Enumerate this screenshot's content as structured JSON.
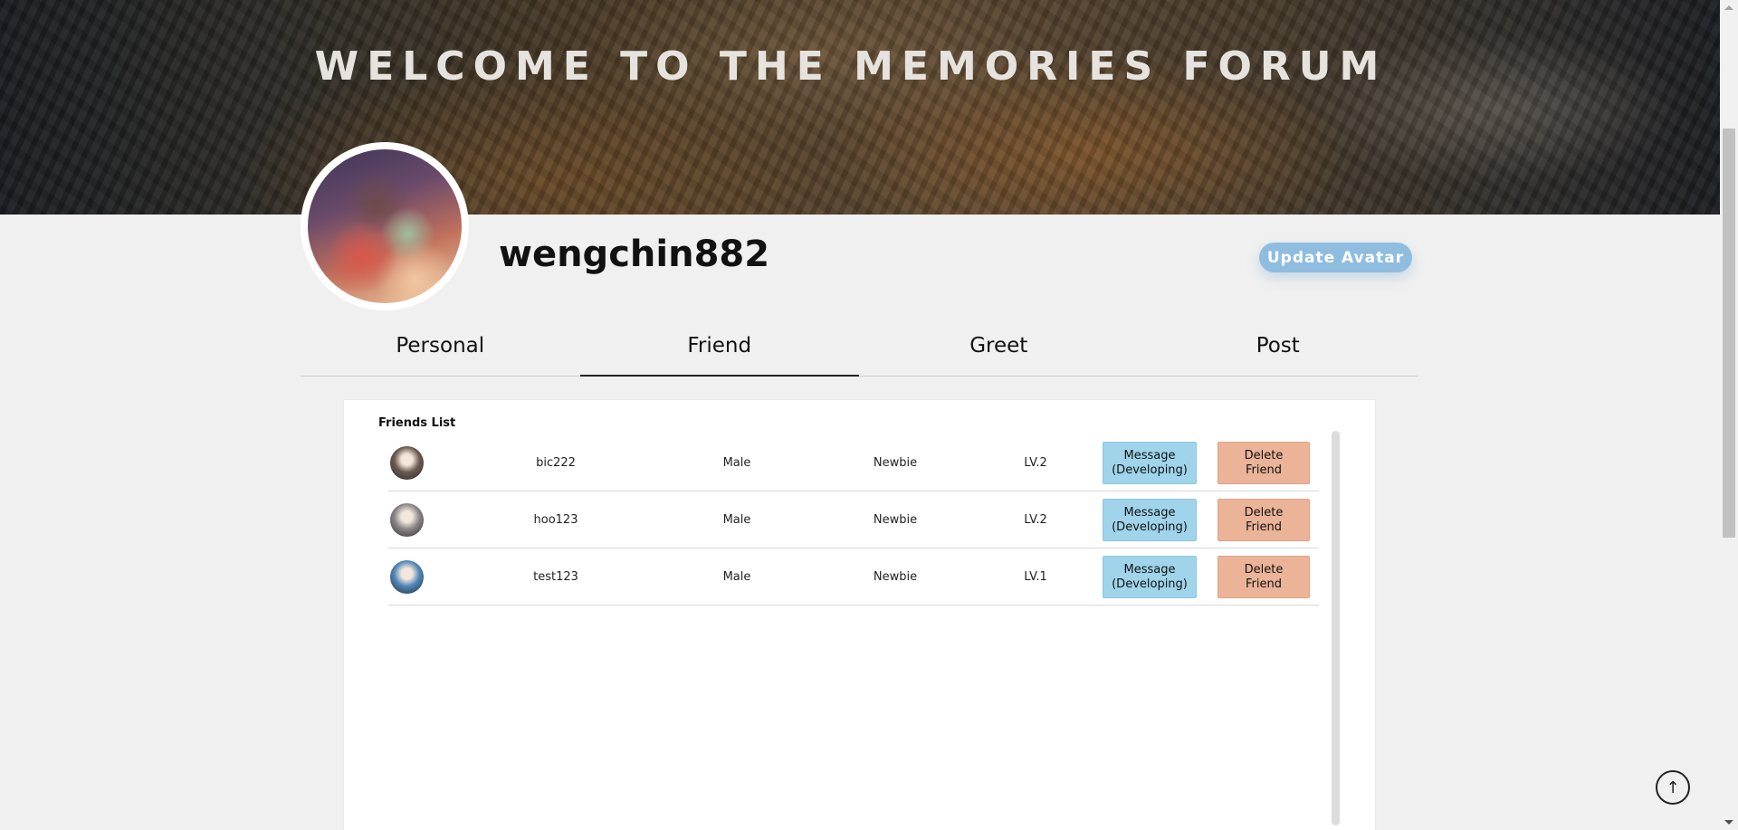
{
  "banner": {
    "title": "WELCOME TO THE MEMORIES FORUM"
  },
  "profile": {
    "username": "wengchin882",
    "update_avatar_label": "Update Avatar"
  },
  "tabs": [
    {
      "label": "Personal",
      "active": false
    },
    {
      "label": "Friend",
      "active": true
    },
    {
      "label": "Greet",
      "active": false
    },
    {
      "label": "Post",
      "active": false
    }
  ],
  "friends": {
    "title": "Friends List",
    "rows": [
      {
        "name": "bic222",
        "gender": "Male",
        "rank": "Newbie",
        "level": "LV.2",
        "message_label": "Message\n(Developing)",
        "delete_label": "Delete\nFriend",
        "avatar_color": "#6a5a4e"
      },
      {
        "name": "hoo123",
        "gender": "Male",
        "rank": "Newbie",
        "level": "LV.2",
        "message_label": "Message\n(Developing)",
        "delete_label": "Delete\nFriend",
        "avatar_color": "#8a8488"
      },
      {
        "name": "test123",
        "gender": "Male",
        "rank": "Newbie",
        "level": "LV.1",
        "message_label": "Message\n(Developing)",
        "delete_label": "Delete\nFriend",
        "avatar_color": "#4e86b8"
      }
    ]
  },
  "colors": {
    "message_button": "#9fd4ea",
    "delete_button": "#ebb398",
    "update_button": "#8fbde0"
  },
  "icons": {
    "back_to_top": "arrow-up-icon"
  }
}
